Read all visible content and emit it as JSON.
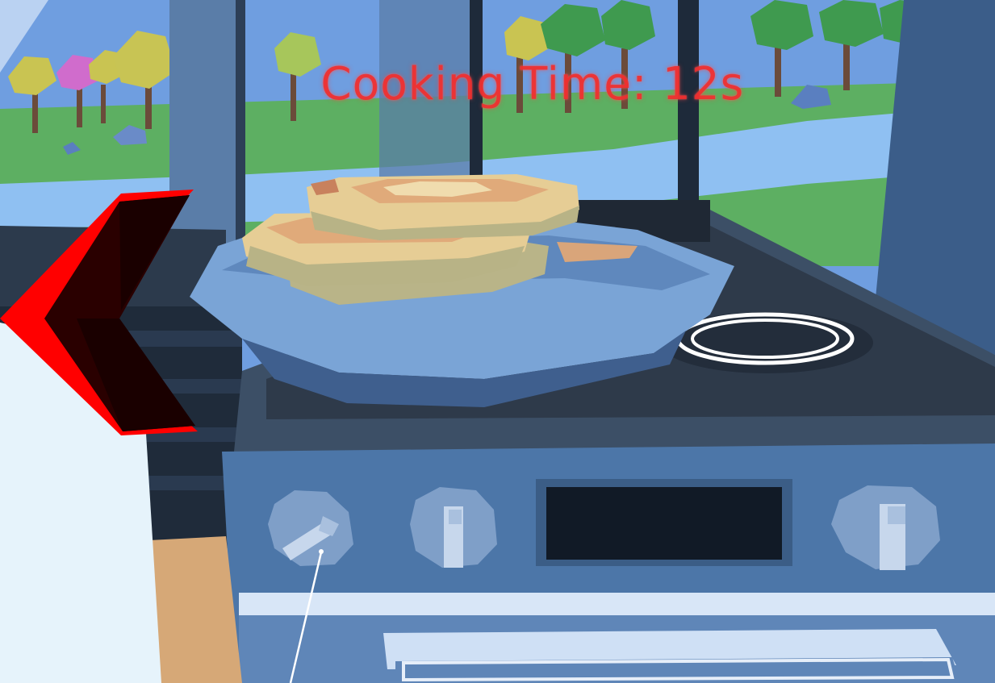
{
  "hud": {
    "cooking_time_text": "Cooking Time: 12s",
    "text_color": "#ee2a2a"
  },
  "scene": {
    "items": [
      "window",
      "trees",
      "river",
      "stove",
      "frying-pan",
      "pancake-stack",
      "stove-knob-left",
      "stove-knob-center",
      "stove-knob-right",
      "stove-display",
      "burner-ring",
      "back-arrow-icon",
      "pointer-ray"
    ]
  },
  "colors": {
    "sky": "#6f9ee0",
    "grass": "#5daf62",
    "river": "#8fc0f2",
    "stove": "#4c76a8",
    "pan": "#7aa4d6",
    "pancake": "#e6cd95",
    "arrow": "#ff0000"
  }
}
